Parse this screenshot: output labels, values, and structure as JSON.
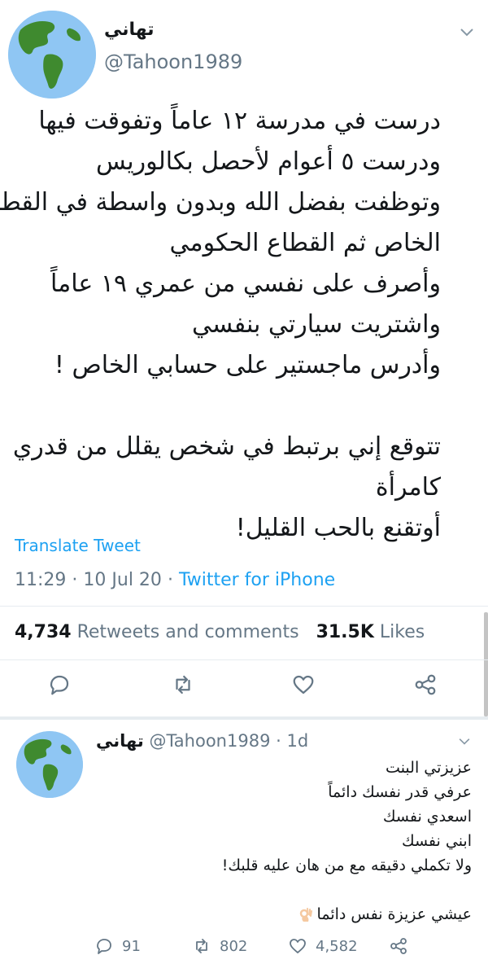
{
  "tweet": {
    "display_name": "تهاني",
    "handle": "@Tahoon1989",
    "body_lines": [
      "درست في مدرسة ١٢ عاماً وتفوقت فيها",
      "ودرست  ٥ أعوام لأحصل بكالوريس",
      "وتوظفت بفضل الله وبدون واسطة في القطاع",
      "الخاص ثم القطاع الحكومي",
      "وأصرف على نفسي من عمري ١٩ عاماً",
      "واشتريت سيارتي بنفسي",
      "وأدرس ماجستير على حسابي الخاص !",
      "",
      "تتوقع إني برتبط في شخص يقلل من قدري",
      "كامرأة",
      "أوتقنع بالحب القليل!"
    ],
    "translate_label": "Translate Tweet",
    "time": "11:29",
    "date": "10 Jul 20",
    "source": "Twitter for iPhone",
    "retweets_count": "4,734",
    "retweets_label": "Retweets and comments",
    "likes_count": "31.5K",
    "likes_label": "Likes"
  },
  "reply": {
    "display_name": "تهاني",
    "handle": "@Tahoon1989",
    "age": "1d",
    "body_lines": [
      "عزيزتي البنت",
      "عرفي قدر نفسك دائماً",
      "اسعدي نفسك",
      "ابني نفسك",
      "ولا تكملي دقيقه مع من هان عليه قلبك!",
      "",
      "عيشي عزيزة نفس دائما"
    ],
    "replies_count": "91",
    "retweets_count": "802",
    "likes_count": "4,582"
  },
  "icons": [
    "globe-avatar",
    "chevron-down-icon",
    "comment-icon",
    "retweet-icon",
    "heart-icon",
    "share-icon",
    "ok-hand-emoji"
  ],
  "colors": {
    "link": "#1da1f2",
    "secondary": "#657786",
    "text": "#14171a",
    "divider": "#e6ecf0",
    "avatar_ocean": "#8fc6f3",
    "avatar_land": "#3f8a2f"
  }
}
